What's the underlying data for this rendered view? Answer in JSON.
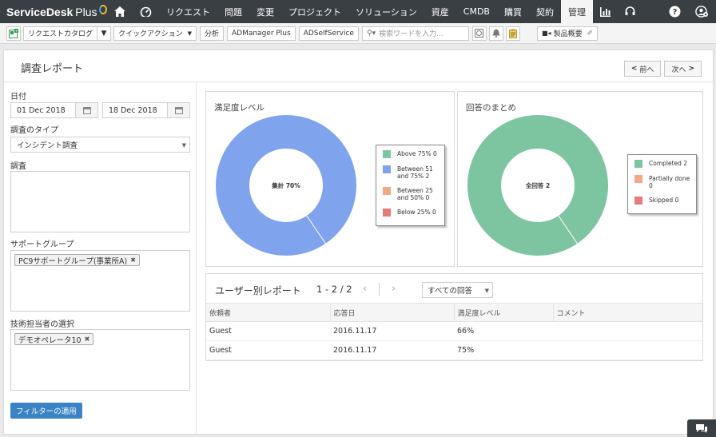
{
  "brand": {
    "name": "ServiceDesk",
    "suffix": "Plus"
  },
  "nav": {
    "items": [
      "リクエスト",
      "問題",
      "変更",
      "プロジェクト",
      "ソリューション",
      "資産",
      "CMDB",
      "購買",
      "契約",
      "管理"
    ],
    "active": "管理"
  },
  "toolbar": {
    "catalog": "リクエストカタログ",
    "quick_action": "クイックアクション",
    "analysis": "分析",
    "admanager": "ADManager Plus",
    "adselfservice": "ADSelfService",
    "search_placeholder": "検索ワードを入力...",
    "product_overview": "製品概要"
  },
  "page": {
    "title": "調査レポート",
    "prev": "前へ",
    "next": "次へ"
  },
  "filters": {
    "date_label": "日付",
    "date_from": "01 Dec 2018",
    "date_to": "18 Dec 2018",
    "survey_type_label": "調査のタイプ",
    "survey_type_value": "インシデント調査",
    "survey_label": "調査",
    "support_group_label": "サポートグループ",
    "support_group_tag": "PC9サポートグループ(事業所A)",
    "technician_label": "技術担当者の選択",
    "technician_tag": "デモオペレータ10",
    "apply_button": "フィルターの適用"
  },
  "chart_data": [
    {
      "type": "pie",
      "title": "満足度レベル",
      "center_label": "集計 70%",
      "categories": [
        "Above 75%",
        "Between 51 and 75%",
        "Between 25 and 50%",
        "Below 25%"
      ],
      "values": [
        0,
        2,
        0,
        0
      ],
      "legend": [
        "Above 75% 0",
        "Between 51 and 75% 2",
        "Between 25 and 50% 0",
        "Below 25% 0"
      ],
      "colors": [
        "#7cc5a0",
        "#7fa3ec",
        "#f3a985",
        "#e97a7a"
      ],
      "legend_position": "right"
    },
    {
      "type": "pie",
      "title": "回答のまとめ",
      "center_label": "全回答 2",
      "categories": [
        "Completed",
        "Partially done",
        "Skipped"
      ],
      "values": [
        2,
        0,
        0
      ],
      "legend": [
        "Completed 2",
        "Partially done 0",
        "Skipped 0"
      ],
      "colors": [
        "#7cc5a0",
        "#f3a985",
        "#e97a7a"
      ],
      "legend_position": "right"
    }
  ],
  "user_report": {
    "title": "ユーザー別レポート",
    "range": "1 - 2 / 2",
    "filter": "すべての回答",
    "columns": [
      "依頼者",
      "応答日",
      "満足度レベル",
      "コメント"
    ],
    "rows": [
      [
        "Guest",
        "2016.11.17",
        "66%",
        ""
      ],
      [
        "Guest",
        "2016.11.17",
        "75%",
        ""
      ]
    ]
  }
}
